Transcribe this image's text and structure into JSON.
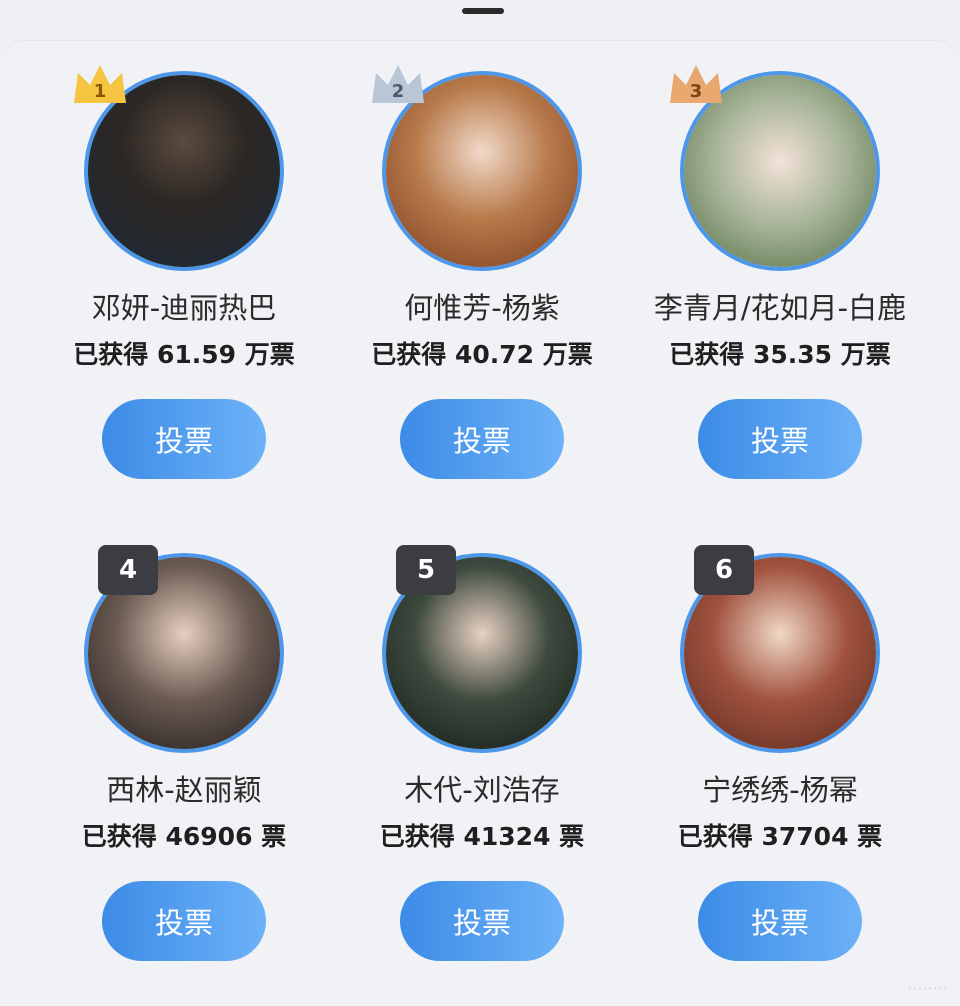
{
  "candidates": [
    {
      "rank": "1",
      "name": "邓妍-迪丽热巴",
      "votes": "已获得 61.59 万票",
      "button": "投票",
      "badge": "crown-gold"
    },
    {
      "rank": "2",
      "name": "何惟芳-杨紫",
      "votes": "已获得 40.72 万票",
      "button": "投票",
      "badge": "crown-silver"
    },
    {
      "rank": "3",
      "name": "李青月/花如月-白鹿",
      "votes": "已获得 35.35 万票",
      "button": "投票",
      "badge": "crown-bronze"
    },
    {
      "rank": "4",
      "name": "西林-赵丽颖",
      "votes": "已获得 46906 票",
      "button": "投票",
      "badge": "rank-box"
    },
    {
      "rank": "5",
      "name": "木代-刘浩存",
      "votes": "已获得 41324 票",
      "button": "投票",
      "badge": "rank-box"
    },
    {
      "rank": "6",
      "name": "宁绣绣-杨幂",
      "votes": "已获得 37704 票",
      "button": "投票",
      "badge": "rank-box"
    }
  ],
  "colors": {
    "accent": "#4c97ea",
    "button_start": "#3c8be6",
    "button_end": "#6db2f8",
    "gold": "#f5c542",
    "silver": "#b9c6d6",
    "bronze": "#e8a870",
    "rank_box": "#3b3d42"
  },
  "watermark": "········"
}
